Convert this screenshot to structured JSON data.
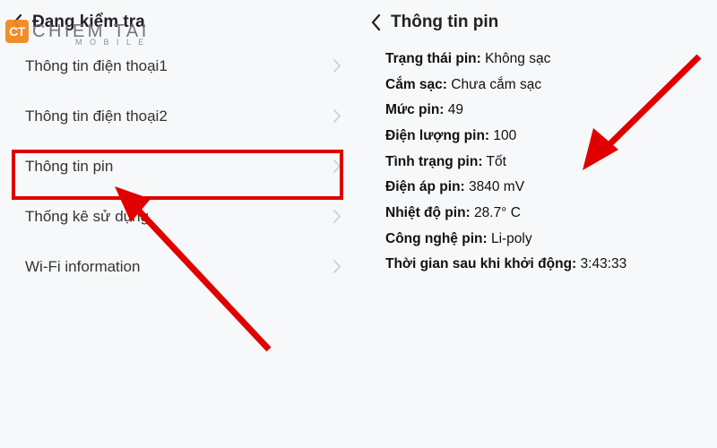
{
  "watermark": {
    "badge": "CT",
    "brand": "CHIEM TAI",
    "sub": "M O B I L E"
  },
  "left": {
    "title": "Đang kiểm tra",
    "items": [
      {
        "label": "Thông tin điện thoại1"
      },
      {
        "label": "Thông tin điện thoại2"
      },
      {
        "label": "Thông tin pin"
      },
      {
        "label": "Thống kê sử dụng"
      },
      {
        "label": "Wi-Fi information"
      }
    ]
  },
  "right": {
    "title": "Thông tin pin",
    "fields": [
      {
        "label": "Trạng thái pin:",
        "value": "Không sạc"
      },
      {
        "label": "Cắm sạc:",
        "value": "Chưa cắm sạc"
      },
      {
        "label": "Mức pin:",
        "value": "49"
      },
      {
        "label": "Điện lượng pin:",
        "value": "100"
      },
      {
        "label": "Tình trạng pin:",
        "value": "Tốt"
      },
      {
        "label": "Điện áp pin:",
        "value": "3840 mV"
      },
      {
        "label": "Nhiệt độ pin:",
        "value": "28.7° C"
      },
      {
        "label": "Công nghệ pin:",
        "value": "Li-poly"
      },
      {
        "label": "Thời gian sau khi khởi động:",
        "value": "3:43:33"
      }
    ]
  },
  "colors": {
    "accent_red": "#e00000"
  }
}
